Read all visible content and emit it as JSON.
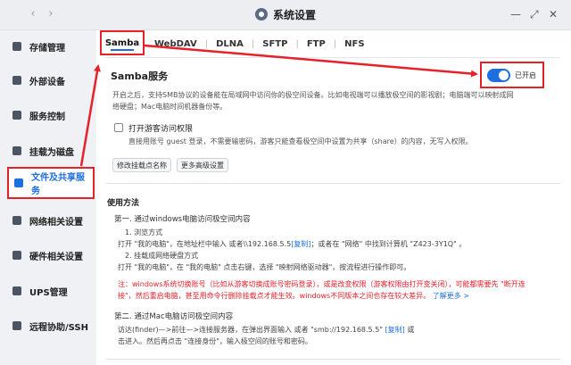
{
  "window": {
    "title": "系统设置",
    "back_icon": "chevron-left-icon",
    "forward_icon": "chevron-right-icon"
  },
  "window_controls": {
    "minimize": "—",
    "maximize": "⤢",
    "close": "✕"
  },
  "sidebar": {
    "items": [
      {
        "label": "存储管理",
        "icon": "storage-icon"
      },
      {
        "label": "外部设备",
        "icon": "external-device-icon"
      },
      {
        "label": "服务控制",
        "icon": "service-icon"
      },
      {
        "label": "挂载为磁盘",
        "icon": "mount-disk-icon"
      },
      {
        "label": "文件及共享服务",
        "icon": "file-share-icon",
        "active": true
      },
      {
        "label": "网络相关设置",
        "icon": "network-icon"
      },
      {
        "label": "硬件相关设置",
        "icon": "hardware-icon"
      },
      {
        "label": "UPS管理",
        "icon": "ups-icon"
      },
      {
        "label": "远程协助/SSH",
        "icon": "remote-icon"
      }
    ]
  },
  "tabs": [
    "Samba",
    "WebDAV",
    "DLNA",
    "SFTP",
    "FTP",
    "NFS"
  ],
  "samba": {
    "title": "Samba服务",
    "toggle_label": "已开启",
    "toggle_on": true,
    "desc_line1": "开启之后，支持SMB协议的设备能在局域网中访问你的极空间设备。比如电视端可以播放极空间的影视剧；电脑端可以映射成网",
    "desc_line2": "络硬盘；Mac电脑时间机器备份等。",
    "guest_label": "打开游客访问权限",
    "guest_desc": "直接用账号 guest 登录，不需要输密码，游客只能查看极空间中设置为共享（share）的内容，无写入权限。",
    "btn_rename": "修改挂载点名称",
    "btn_more": "更多高级设置"
  },
  "usage": {
    "title": "使用方法",
    "step1_title": "第一. 通过windows电脑访问极空间内容",
    "step1_a": "1. 浏览方式",
    "step1_a_text_pre": "打开 \"我的电脑\"，在地址栏中输入 或者\\\\192.168.5.5",
    "step1_a_copy": "[复制]",
    "step1_a_text_post": "；或者在 \"网络\" 中找到计算机 \"Z423-3Y1Q\" 。",
    "step1_b": "2. 挂载成网络硬盘方式",
    "step1_b_text": "打开 \"我的电脑\"，在 \"我的电脑\" 点击右键，选择 \"映射网络驱动器\"，按流程进行操作即可。",
    "note_line1": "注：windows系统切换账号（比如从游客切换成账号密码登录），或是改变权限（游客权限由打开变关闭），可能都需要先 \"断开连",
    "note_line2_pre": "接\"，然后重启电脑，甚至用命令行删除挂载点才能生效。windows不同版本之间也存在较大差异。",
    "note_more": "了解更多 >",
    "step2_title": "第二. 通过Mac电脑访问极空间内容",
    "step2_text_pre": "访达(finder)—>前往—>连接服务器，在弹出界面输入 或者 \"smb://192.168.5.5\"",
    "step2_copy": "[复制]",
    "step2_text_post": "或",
    "step2_line2": "击进入。然后再点击 \"连接身份\"，输入极空间的账号和密码。"
  }
}
